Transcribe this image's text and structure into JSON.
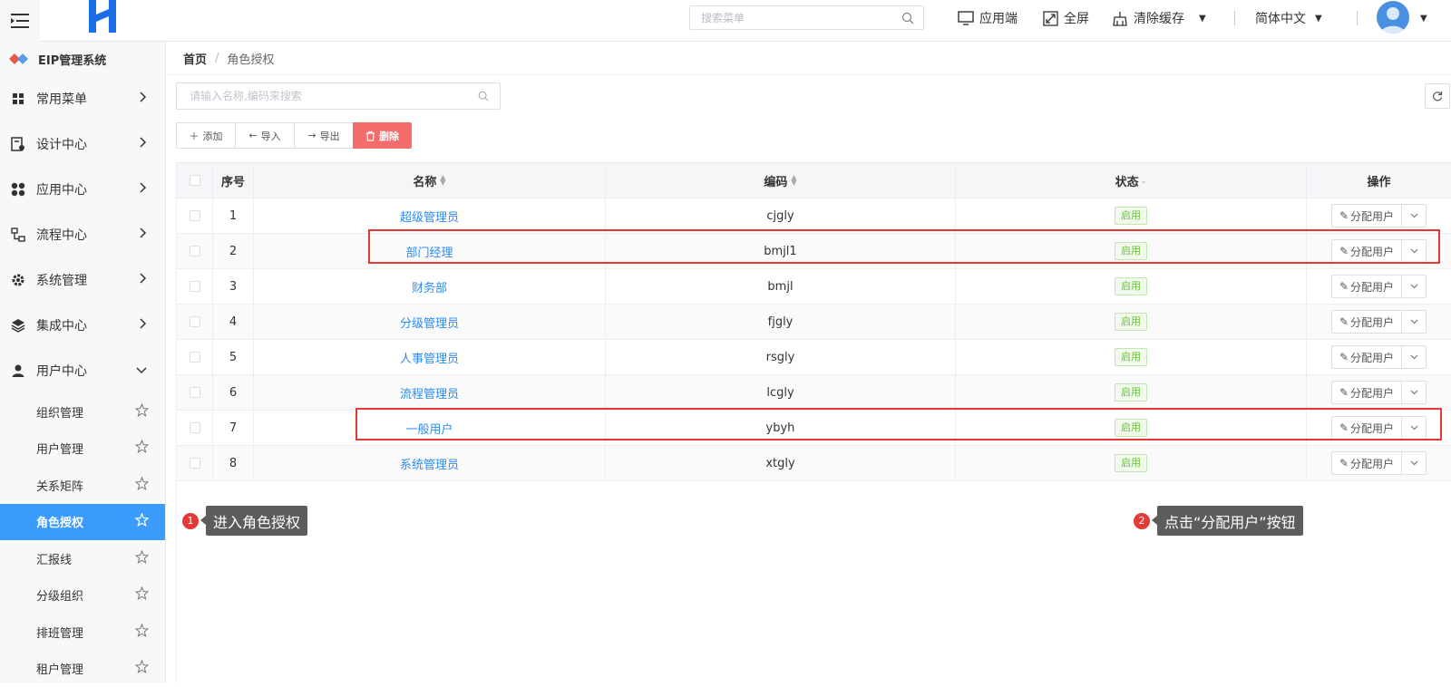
{
  "header": {
    "search_placeholder": "搜索菜单",
    "app_client": "应用端",
    "fullscreen": "全屏",
    "clear_cache": "清除缓存",
    "language": "简体中文"
  },
  "sidebar": {
    "system_title": "EIP管理系统",
    "nav": [
      {
        "label": "常用菜单",
        "icon": "grid-icon"
      },
      {
        "label": "设计中心",
        "icon": "design-icon"
      },
      {
        "label": "应用中心",
        "icon": "apps-icon"
      },
      {
        "label": "流程中心",
        "icon": "flow-icon"
      },
      {
        "label": "系统管理",
        "icon": "gear-icon"
      },
      {
        "label": "集成中心",
        "icon": "layers-icon"
      },
      {
        "label": "用户中心",
        "icon": "user-icon"
      }
    ],
    "sub_items": [
      {
        "label": "组织管理"
      },
      {
        "label": "用户管理"
      },
      {
        "label": "关系矩阵"
      },
      {
        "label": "角色授权"
      },
      {
        "label": "汇报线"
      },
      {
        "label": "分级组织"
      },
      {
        "label": "排班管理"
      },
      {
        "label": "租户管理"
      }
    ]
  },
  "breadcrumb": {
    "home": "首页",
    "current": "角色授权"
  },
  "main": {
    "search_placeholder": "请输入名称,编码来搜索",
    "buttons": {
      "add": "添加",
      "import": "导入",
      "export": "导出",
      "delete": "删除"
    }
  },
  "table": {
    "headers": {
      "index": "序号",
      "name": "名称",
      "code": "编码",
      "status": "状态",
      "operation": "操作"
    },
    "rows": [
      {
        "index": "1",
        "name": "超级管理员",
        "code": "cjgly",
        "status": "启用",
        "action": "分配用户"
      },
      {
        "index": "2",
        "name": "部门经理",
        "code": "bmjl1",
        "status": "启用",
        "action": "分配用户"
      },
      {
        "index": "3",
        "name": "财务部",
        "code": "bmjl",
        "status": "启用",
        "action": "分配用户"
      },
      {
        "index": "4",
        "name": "分级管理员",
        "code": "fjgly",
        "status": "启用",
        "action": "分配用户"
      },
      {
        "index": "5",
        "name": "人事管理员",
        "code": "rsgly",
        "status": "启用",
        "action": "分配用户"
      },
      {
        "index": "6",
        "name": "流程管理员",
        "code": "lcgly",
        "status": "启用",
        "action": "分配用户"
      },
      {
        "index": "7",
        "name": "一般用户",
        "code": "ybyh",
        "status": "启用",
        "action": "分配用户"
      },
      {
        "index": "8",
        "name": "系统管理员",
        "code": "xtgly",
        "status": "启用",
        "action": "分配用户"
      }
    ]
  },
  "annotations": [
    {
      "number": "1",
      "text": "进入角色授权"
    },
    {
      "number": "2",
      "text": "点击“分配用户”按钮"
    }
  ],
  "colors": {
    "accent": "#3c9cfd",
    "link": "#2d8cf0",
    "danger": "#f56c6c",
    "highlight": "#e53935",
    "success": "#67c23a"
  }
}
